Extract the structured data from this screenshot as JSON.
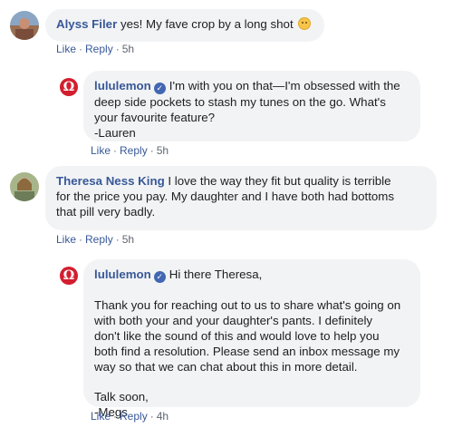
{
  "comments": [
    {
      "author": "Alyss Filer",
      "text": "yes! My fave crop by a long shot",
      "emoji": "smiling-face-emoji",
      "like": "Like",
      "reply": "Reply",
      "time": "5h"
    },
    {
      "author": "lululemon",
      "line1": "I'm with you on that—I'm obsessed with the",
      "line2": "deep side pockets to stash my tunes on the go. What's",
      "line3": "your favourite feature?",
      "line4": "-Lauren",
      "like": "Like",
      "reply": "Reply",
      "time": "5h"
    },
    {
      "author": "Theresa Ness King",
      "line1": "I love the way they fit but quality is terrible",
      "line2": "for the price you pay. My daughter and I have both had bottoms",
      "line3": "that pill very badly.",
      "like": "Like",
      "reply": "Reply",
      "time": "5h"
    },
    {
      "author": "lululemon",
      "greeting": "Hi there Theresa,",
      "body": [
        "Thank you for reaching out to us to share what's going on",
        "with both your and your daughter's pants. I definitely",
        "don't like the sound of this and would love to help you",
        "both find a resolution. Please send an inbox message my",
        "way so that we can chat about this in more detail."
      ],
      "signoff1": "Talk soon,",
      "signoff2": "-Megs",
      "like": "Like",
      "reply": "Reply",
      "time": "4h"
    }
  ],
  "verified_glyph": "✓",
  "logo_glyph": "Ω",
  "dot": "·",
  "colors": {
    "name": "#385898",
    "bubble": "#f2f3f5",
    "verified": "#4267b2",
    "brand": "#d31e2f"
  }
}
